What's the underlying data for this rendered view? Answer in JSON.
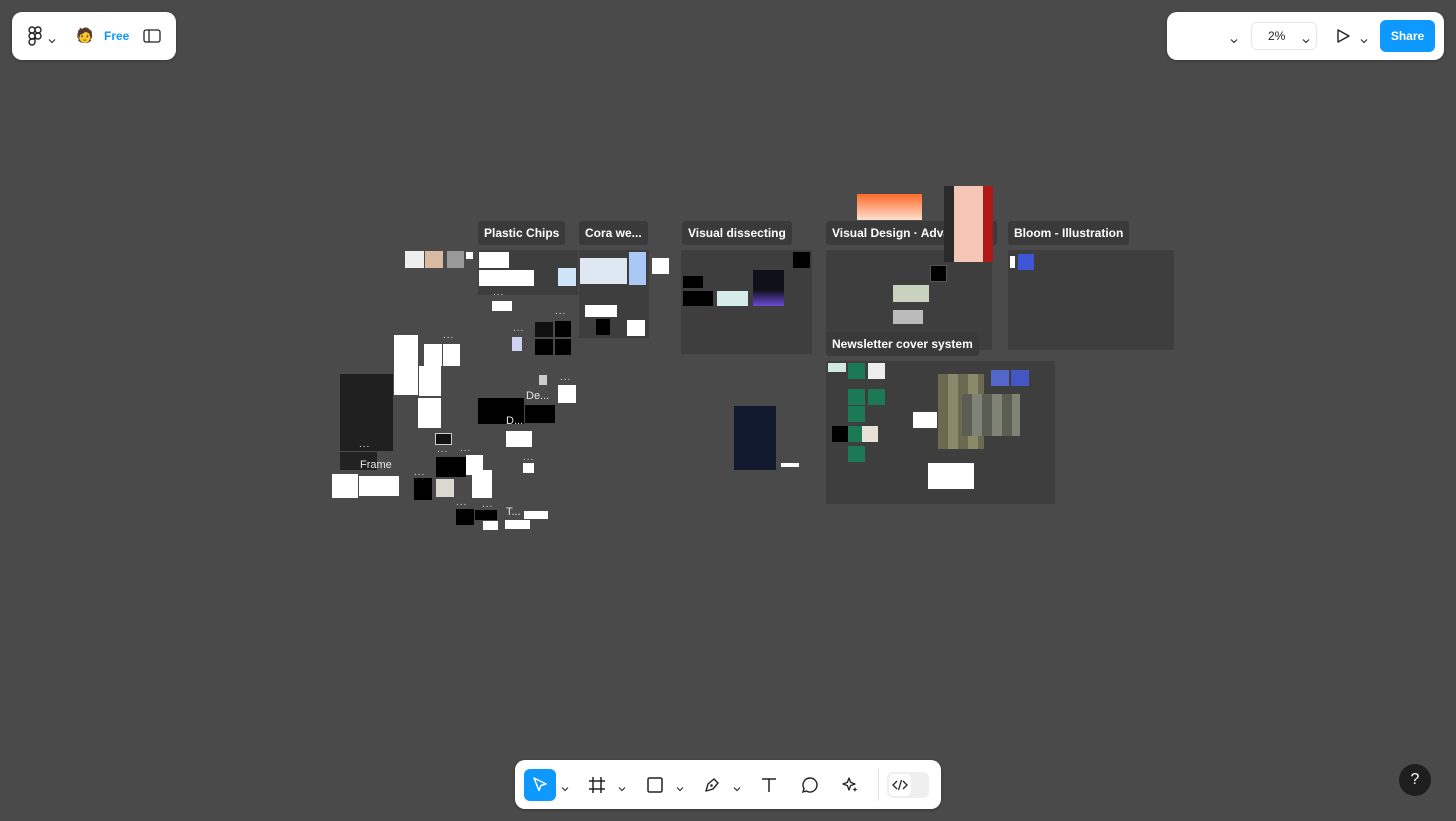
{
  "header": {
    "plan_badge": "Free",
    "zoom_level": "2%",
    "share_label": "Share"
  },
  "sections": [
    {
      "label": "Plastic Chips"
    },
    {
      "label": "Cora we..."
    },
    {
      "label": "Visual dissecting"
    },
    {
      "label": "Visual Design · Advanced ..."
    },
    {
      "label": "Bloom - Illustration"
    },
    {
      "label": "Newsletter cover system"
    }
  ],
  "canvas_labels": {
    "frame": "Frame",
    "de": "De...",
    "d": "D...",
    "t": "T..."
  },
  "toolbar": {
    "tools": [
      "move-tool",
      "frame-tool",
      "shape-tool",
      "pen-tool",
      "text-tool",
      "comment-tool",
      "actions-tool",
      "dev-mode-toggle"
    ]
  },
  "help_label": "?",
  "colors": {
    "canvas": "#4a4a4a",
    "accent": "#0d99ff"
  }
}
